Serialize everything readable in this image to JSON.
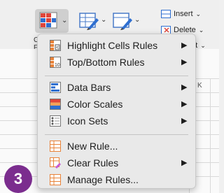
{
  "ribbon": {
    "insert_label": "Insert",
    "delete_label": "Delete",
    "format_label": "at",
    "cut_letters": [
      "C",
      "F"
    ]
  },
  "sheet": {
    "column_label": "K"
  },
  "menu": {
    "items": [
      {
        "label": "Highlight Cells Rules",
        "has_submenu": true,
        "icon": "highlight-cells-icon"
      },
      {
        "label": "Top/Bottom Rules",
        "has_submenu": true,
        "icon": "top-bottom-icon"
      },
      {
        "label": "Data Bars",
        "has_submenu": true,
        "icon": "data-bars-icon"
      },
      {
        "label": "Color Scales",
        "has_submenu": true,
        "icon": "color-scales-icon"
      },
      {
        "label": "Icon Sets",
        "has_submenu": true,
        "icon": "icon-sets-icon"
      },
      {
        "label": "New Rule...",
        "has_submenu": false,
        "icon": "new-rule-icon"
      },
      {
        "label": "Clear Rules",
        "has_submenu": true,
        "icon": "clear-rules-icon"
      },
      {
        "label": "Manage Rules...",
        "has_submenu": false,
        "icon": "manage-rules-icon"
      }
    ],
    "submenu_glyph": "▶"
  },
  "step_badge": "3",
  "colors": {
    "badge": "#7b2d8e",
    "menu_bg": "#e9e9e9",
    "accent_orange": "#e8833a",
    "accent_red": "#e0453a",
    "accent_blue": "#2f6fd0"
  }
}
